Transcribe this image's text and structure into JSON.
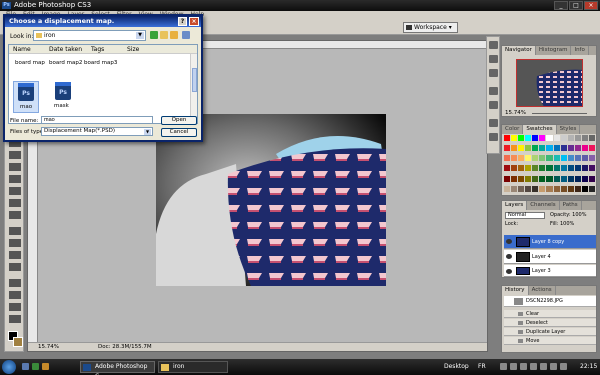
{
  "app": {
    "title": "Adobe Photoshop CS3",
    "icon": "ps-icon"
  },
  "menubar": [
    "File",
    "Edit",
    "Image",
    "Layer",
    "Select",
    "Filter",
    "View",
    "Window",
    "Help"
  ],
  "optionsbar": {
    "workspace_label": "Workspace"
  },
  "dialog": {
    "title": "Choose a displacement map.",
    "look_in_label": "Look in:",
    "look_in_value": "iron",
    "columns": [
      "Name",
      "Date taken",
      "Tags",
      "Size"
    ],
    "files": [
      "board map",
      "board map2",
      "board map3",
      "mao",
      "mask"
    ],
    "file_name_label": "File name:",
    "file_name_value": "mao",
    "files_of_type_label": "Files of type:",
    "files_of_type_value": "Displacement Map(*.PSD)",
    "open_label": "Open",
    "cancel_label": "Cancel",
    "psd_badge": "Ps"
  },
  "document": {
    "zoom": "15.74%",
    "doc_info": "Doc: 28.3M/155.7M"
  },
  "navigator": {
    "tabs": [
      "Navigator",
      "Histogram",
      "Info"
    ],
    "zoom": "15.74%"
  },
  "swatches": {
    "tabs": [
      "Color",
      "Swatches",
      "Styles"
    ],
    "colors": [
      "#ff0000",
      "#ffff00",
      "#00ff00",
      "#00ffff",
      "#0000ff",
      "#ff00ff",
      "#ffffff",
      "#e6e6e6",
      "#cccccc",
      "#b3b3b3",
      "#999999",
      "#808080",
      "#666666",
      "#ed1c24",
      "#f7941d",
      "#fff200",
      "#8dc63f",
      "#00a651",
      "#00a99d",
      "#00aeef",
      "#0072bc",
      "#2e3192",
      "#662d91",
      "#92278f",
      "#ec008c",
      "#ed145b",
      "#f26c4f",
      "#f68e56",
      "#fbaf5d",
      "#fff568",
      "#acd373",
      "#7cc576",
      "#3bb878",
      "#1abbb4",
      "#00bff3",
      "#438ccb",
      "#5574b9",
      "#605ca8",
      "#855fa8",
      "#9e0b0f",
      "#a0410d",
      "#a3620a",
      "#aba000",
      "#598527",
      "#197b30",
      "#007236",
      "#00746b",
      "#0076a3",
      "#004a80",
      "#003471",
      "#1b1464",
      "#440e62",
      "#790000",
      "#7b2e00",
      "#7d4900",
      "#827b00",
      "#406618",
      "#005e20",
      "#005826",
      "#005952",
      "#005b7f",
      "#003663",
      "#002157",
      "#0d004c",
      "#32004b",
      "#c7b299",
      "#998675",
      "#736357",
      "#534741",
      "#37302a",
      "#c69c6d",
      "#a67c52",
      "#8c6239",
      "#754c24",
      "#603913",
      "#3c2415",
      "#000000",
      "#262626"
    ]
  },
  "layers": {
    "tabs": [
      "Layers",
      "Channels",
      "Paths"
    ],
    "blend_mode": "Normal",
    "opacity_label": "Opacity:",
    "opacity_value": "100%",
    "lock_label": "Lock:",
    "fill_label": "Fill:",
    "fill_value": "100%",
    "items": [
      "Layer 8 copy",
      "Layer 4",
      "Layer 3"
    ]
  },
  "history": {
    "tabs": [
      "History",
      "Actions"
    ],
    "snapshot": "DSCN2298.JPG",
    "items": [
      "Clear",
      "Deselect",
      "Duplicate Layer",
      "Move"
    ]
  },
  "taskbar": {
    "task1": "Adobe Photoshop C...",
    "task2": "iron",
    "desktop": "Desktop",
    "lang": "FR",
    "clock": "22:15"
  },
  "colors": {
    "selection": "#3a6ccc",
    "pattern_bg": "#1e2a6b",
    "pattern_fg": "#f3c7cf"
  }
}
